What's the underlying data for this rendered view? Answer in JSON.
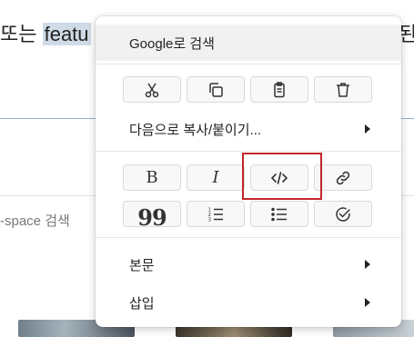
{
  "background": {
    "text_before": "또는 ",
    "selected_text": "featu",
    "right_fragment": "된",
    "search_hint": "-space 검색"
  },
  "menu": {
    "google_search_label": "Google로 검색",
    "copy_paste_label": "다음으로 복사/붙이기...",
    "body_label": "본문",
    "insert_label": "삽입",
    "clipboard_tools": [
      "cut-icon",
      "copy-icon",
      "paste-icon",
      "delete-icon"
    ],
    "format_tools": {
      "bold_glyph": "B",
      "italic_glyph": "I",
      "quote_glyph": "99",
      "icons": [
        "code-icon",
        "link-icon",
        "numbered-list-icon",
        "bullet-list-icon",
        "checklist-icon"
      ]
    },
    "highlight_color": "#c0272d"
  }
}
